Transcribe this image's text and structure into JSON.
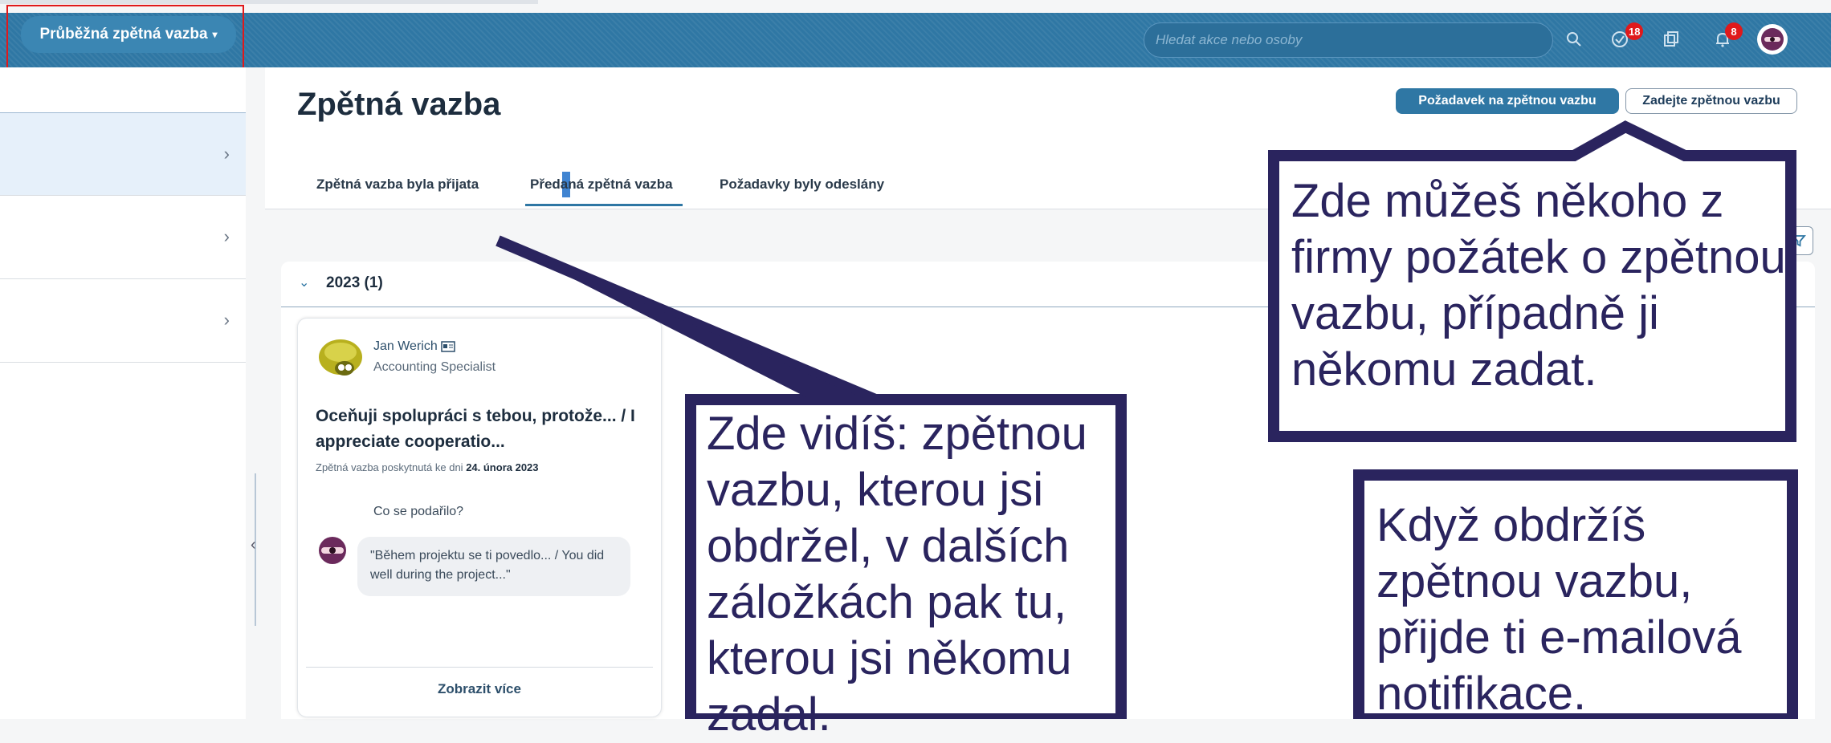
{
  "shell": {
    "app_menu_label": "Průběžná zpětná vazba",
    "search_placeholder": "Hledat akce nebo osoby",
    "notifications_badge": "18",
    "bell_badge": "8"
  },
  "page": {
    "title": "Zpětná vazba",
    "request_button": "Požadavek na zpětnou vazbu",
    "give_button": "Zadejte zpětnou vazbu",
    "tabs": [
      {
        "label": "Zpětná vazba byla přijata"
      },
      {
        "label": "Předaná zpětná vazba"
      },
      {
        "label": "Požadavky byly odeslány"
      }
    ],
    "year_group": "2023 (1)"
  },
  "card": {
    "author": "Jan Werich",
    "role": "Accounting Specialist",
    "title": "Oceňuji spolupráci s tebou, protože... / I appreciate cooperatio...",
    "date_prefix": "Zpětná vazba poskytnutá ke dni",
    "date": "24. února 2023",
    "question": "Co se podařilo?",
    "answer": "\"Během projektu se ti povedlo... / You did well during the project...\"",
    "more_label": "Zobrazit více"
  },
  "callouts": {
    "request": "Zde můžeš někoho z firmy požátek o zpětnou vazbu, případně ji někomu zadat.",
    "tabs": "Zde vidíš: zpětnou vazbu, kterou jsi obdržel, v dalších záložkách pak tu, kterou jsi někomu zadal.",
    "email": "Když obdržíš zpětnou vazbu, přijde ti e-mailová notifikace."
  },
  "colors": {
    "shell": "#2f77a4",
    "callout_border": "#2a245e",
    "highlight_box": "#e0191b"
  }
}
